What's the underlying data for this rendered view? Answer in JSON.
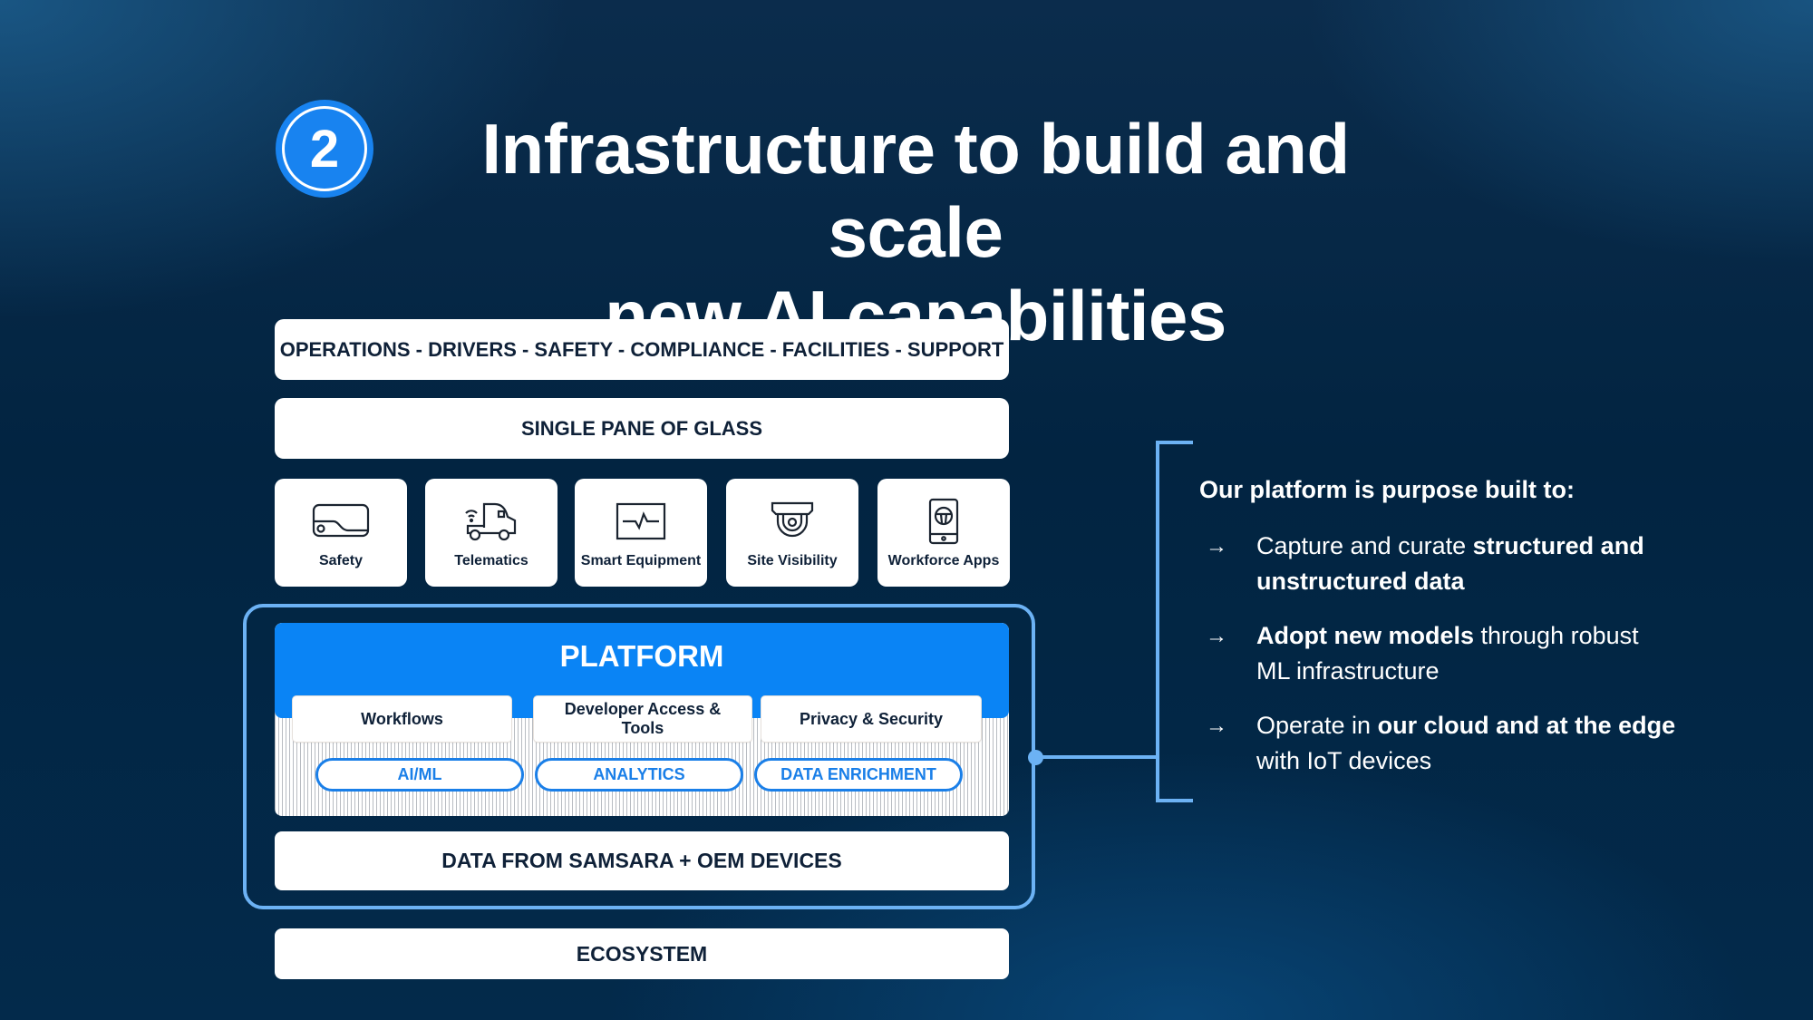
{
  "header": {
    "step_number": "2",
    "title_line1": "Infrastructure to build and scale",
    "title_line2": "new AI capabilities"
  },
  "stack": {
    "top_bar": "OPERATIONS - DRIVERS - SAFETY - COMPLIANCE - FACILITIES - SUPPORT",
    "glass_bar": "SINGLE PANE OF GLASS",
    "tiles": [
      {
        "label": "Safety",
        "icon": "dashcam-icon"
      },
      {
        "label": "Telematics",
        "icon": "truck-wifi-icon"
      },
      {
        "label": "Smart Equipment",
        "icon": "pulse-monitor-icon"
      },
      {
        "label": "Site Visibility",
        "icon": "dome-camera-icon"
      },
      {
        "label": "Workforce Apps",
        "icon": "phone-steering-icon"
      }
    ],
    "platform": {
      "title": "PLATFORM",
      "cards": [
        "Workflows",
        "Developer Access & Tools",
        "Privacy & Security"
      ],
      "pills": [
        "AI/ML",
        "ANALYTICS",
        "DATA ENRICHMENT"
      ]
    },
    "data_bar": "DATA FROM SAMSARA + OEM DEVICES",
    "ecosystem_bar": "ECOSYSTEM"
  },
  "panel": {
    "heading": "Our platform is purpose built to:",
    "arrow_glyph": "→",
    "bullets": [
      {
        "parts": [
          {
            "t": "Capture and curate ",
            "b": false
          },
          {
            "t": "structured and unstructured data",
            "b": true
          }
        ]
      },
      {
        "parts": [
          {
            "t": "Adopt new models",
            "b": true
          },
          {
            "t": " through robust ML infrastructure",
            "b": false
          }
        ]
      },
      {
        "parts": [
          {
            "t": "Operate in ",
            "b": false
          },
          {
            "t": "our cloud and at the edge",
            "b": true
          },
          {
            "t": " with IoT devices",
            "b": false
          }
        ]
      }
    ]
  },
  "colors": {
    "accent_blue": "#0a84f5",
    "connector_blue": "#6cb2f4",
    "text_dark": "#0f2138",
    "background": "#022441"
  }
}
